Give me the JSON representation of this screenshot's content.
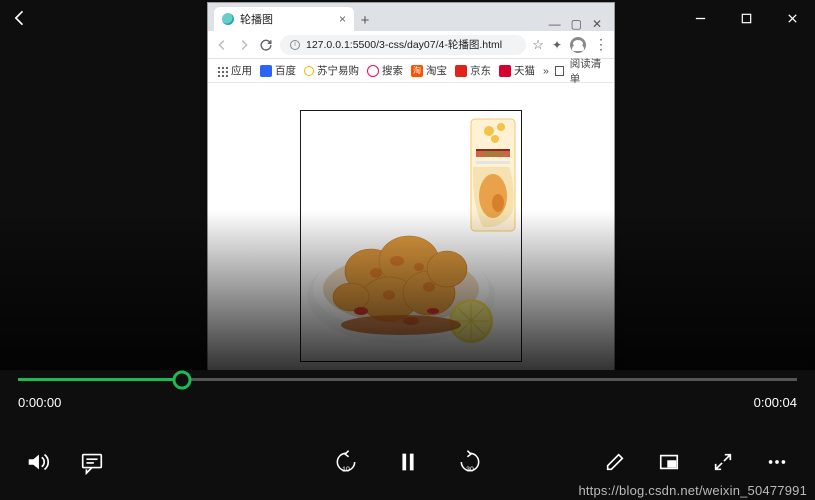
{
  "outer_window": {
    "back_icon": "arrow-left",
    "sys": {
      "minimize": "—",
      "maximize": "▢",
      "close": "✕"
    }
  },
  "chrome": {
    "tab_title": "轮播图",
    "tab_close": "×",
    "tab_add": "+",
    "sys_min": "—",
    "sys_max": "▢",
    "sys_close": "✕",
    "url": "127.0.0.1:5500/3-css/day07/4-轮播图.html",
    "star": "☆",
    "puzzle": "✦",
    "kebab": "⋮",
    "bookmarks": {
      "apps": "应用",
      "baidu": "百度",
      "suning": "苏宁易购",
      "sousuo": "搜索",
      "taobao_icon_text": "淘",
      "taobao": "淘宝",
      "jd": "京东",
      "tmall": "天猫",
      "more": "»",
      "reading_list": "阅读清单"
    }
  },
  "player": {
    "time_current": "0:00:00",
    "time_total": "0:00:04"
  },
  "watermark": "https://blog.csdn.net/weixin_50477991"
}
